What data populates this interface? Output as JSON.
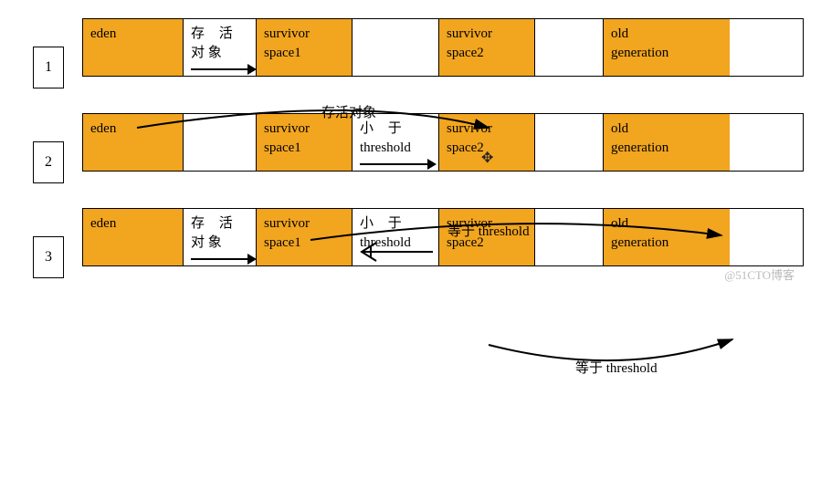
{
  "watermark": "@51CTO博客",
  "steps": [
    {
      "num": "1"
    },
    {
      "num": "2"
    },
    {
      "num": "3"
    }
  ],
  "labels": {
    "eden": "eden",
    "survive_obj_l1": "存  活",
    "survive_obj_l2": "对 象",
    "survivor1_l1": "survivor",
    "survivor1_l2": "space1",
    "survivor2_l1": "survivor",
    "survivor2_l2": "space2",
    "old_l1": "old",
    "old_l2": "generation",
    "lt_threshold_l1": "小    于",
    "lt_threshold_l2": "threshold",
    "arc_survive": "存活对象",
    "arc_eq_threshold": "等于 threshold"
  }
}
